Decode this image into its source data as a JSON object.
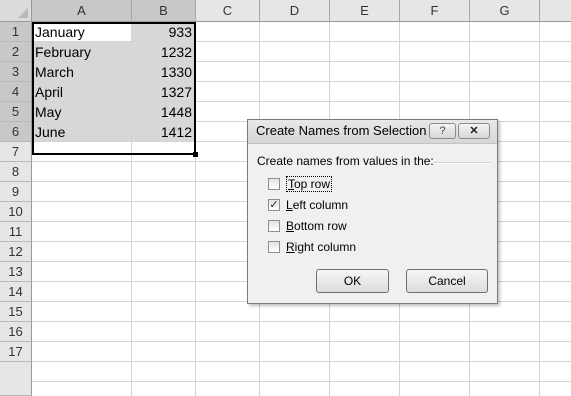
{
  "columns": [
    "A",
    "B",
    "C",
    "D",
    "E",
    "F",
    "G"
  ],
  "rows": [
    "1",
    "2",
    "3",
    "4",
    "5",
    "6",
    "7",
    "8",
    "9",
    "10",
    "11",
    "12",
    "13",
    "14",
    "15",
    "16",
    "17"
  ],
  "cells": [
    {
      "a": "January",
      "b": "933"
    },
    {
      "a": "February",
      "b": "1232"
    },
    {
      "a": "March",
      "b": "1330"
    },
    {
      "a": "April",
      "b": "1327"
    },
    {
      "a": "May",
      "b": "1448"
    },
    {
      "a": "June",
      "b": "1412"
    }
  ],
  "dialog": {
    "title": "Create Names from Selection",
    "help_icon": "?",
    "close_icon": "✕",
    "prompt": "Create names from values in the:",
    "options": [
      {
        "accel": "T",
        "rest": "op row",
        "checked": false
      },
      {
        "accel": "L",
        "rest": "eft column",
        "checked": true
      },
      {
        "accel": "B",
        "rest": "ottom row",
        "checked": false
      },
      {
        "accel": "R",
        "rest": "ight column",
        "checked": false
      }
    ],
    "ok_label": "OK",
    "cancel_label": "Cancel"
  },
  "colors": {
    "selection_fill": "#d7d7d7",
    "header_selected": "#c8c8c8"
  }
}
